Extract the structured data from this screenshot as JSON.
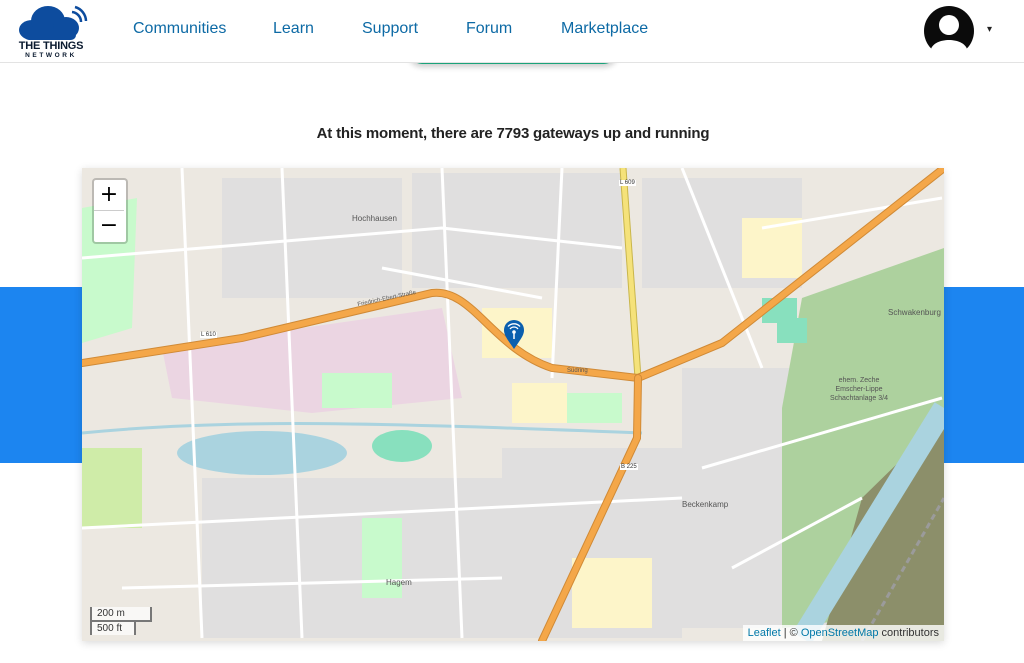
{
  "header": {
    "logo_line1": "THE THINGS",
    "logo_line2": "NETWORK",
    "nav": [
      {
        "label": "Communities"
      },
      {
        "label": "Learn"
      },
      {
        "label": "Support"
      },
      {
        "label": "Forum"
      },
      {
        "label": "Marketplace"
      }
    ],
    "avatar_icon": "user-avatar-icon",
    "menu_icon": "caret-down-icon",
    "caret": "▾"
  },
  "headline": "At this moment, there are 7793 gateways up and running",
  "colors": {
    "nav_text": "#0d6aa5",
    "band": "#1c85f0",
    "marker": "#0b5fae",
    "major_road": "#f4a749",
    "secondary_road": "#f5e27a",
    "forest": "#add19e",
    "water": "#aad3df"
  },
  "map": {
    "zoom_in": "+",
    "zoom_out": "−",
    "scale_metric": "200 m",
    "scale_imperial": "500 ft",
    "attribution_leaflet": "Leaflet",
    "attribution_sep": " | © ",
    "attribution_osm": "OpenStreetMap",
    "attribution_suffix": " contributors",
    "labels": {
      "district_north": "Hochhausen",
      "district_east": "Schwakenburg",
      "district_south": "Hagem",
      "district_southeast": "Beckenkamp",
      "road_l610": "L 610",
      "road_l609": "L 609",
      "road_b225": "B 225",
      "street_ring": "Südring",
      "street_west": "Friedrich-Ebert-Straße",
      "colliery": "ehem. Zeche Emscher-Lippe Schachtanlage 3/4"
    },
    "gateway_marker_icon": "gateway-marker-icon"
  }
}
